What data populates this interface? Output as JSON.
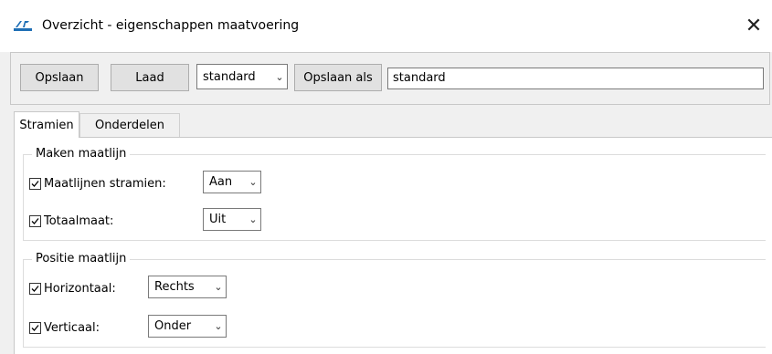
{
  "window": {
    "title": "Overzicht - eigenschappen maatvoering",
    "close_glyph": "✕",
    "icon": "app-icon"
  },
  "toolbar": {
    "save_label": "Opslaan",
    "load_label": "Laad",
    "preset_value": "standard",
    "save_as_label": "Opslaan als",
    "name_value": "standard"
  },
  "tabs": [
    {
      "label": "Stramien",
      "active": true
    },
    {
      "label": "Onderdelen",
      "active": false
    }
  ],
  "groups": {
    "maken": {
      "title": "Maken maatlijn",
      "rows": [
        {
          "label": "Maatlijnen stramien:",
          "checked": true,
          "value": "Aan"
        },
        {
          "label": "Totaalmaat:",
          "checked": true,
          "value": "Uit"
        }
      ]
    },
    "positie": {
      "title": "Positie maatlijn",
      "rows": [
        {
          "label": "Horizontaal:",
          "checked": true,
          "value": "Rechts"
        },
        {
          "label": "Verticaal:",
          "checked": true,
          "value": "Onder"
        }
      ]
    }
  },
  "icons": {
    "dropdown": "chevron-down-icon",
    "check": "checkmark-icon"
  },
  "colors": {
    "window_bg": "#f0f0f0",
    "button_bg": "#e1e1e1",
    "icon_blue": "#1f6fb5"
  }
}
